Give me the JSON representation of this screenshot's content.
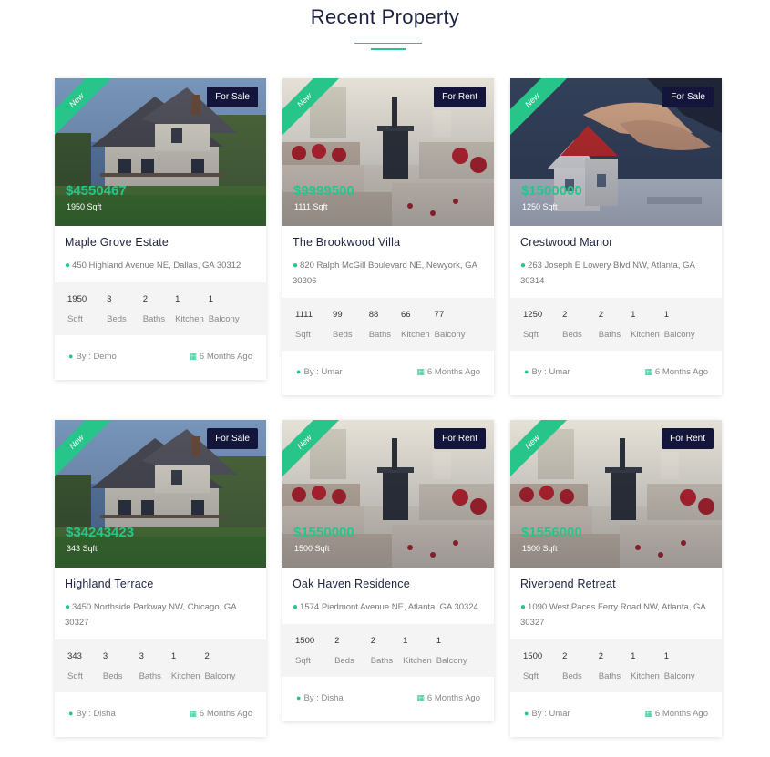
{
  "section": {
    "title": "Recent Property"
  },
  "colors": {
    "accent": "#27c58a",
    "badge": "#13163a"
  },
  "ribbon_label": "New",
  "feature_labels": [
    "Sqft",
    "Beds",
    "Baths",
    "Kitchen",
    "Balcony"
  ],
  "properties": [
    {
      "status": "For Sale",
      "price": "$4550467",
      "area": "1950 Sqft",
      "name": "Maple Grove Estate",
      "address": "450 Highland Avenue NE, Dallas, GA 30312",
      "features": [
        "1950",
        "3",
        "2",
        "1",
        "1"
      ],
      "author": "By : Demo",
      "time": "6 Months Ago",
      "image": "house-icon"
    },
    {
      "status": "For Rent",
      "price": "$9999500",
      "area": "1111 Sqft",
      "name": "The Brookwood Villa",
      "address": "820 Ralph McGill Boulevard NE, Newyork, GA 30306",
      "features": [
        "1111",
        "99",
        "88",
        "66",
        "77"
      ],
      "author": "By : Umar",
      "time": "6 Months Ago",
      "image": "living-room-icon"
    },
    {
      "status": "For Sale",
      "price": "$1500000",
      "area": "1250 Sqft",
      "name": "Crestwood Manor",
      "address": "263 Joseph E Lowery Blvd NW, Atlanta, GA 30314",
      "features": [
        "1250",
        "2",
        "2",
        "1",
        "1"
      ],
      "author": "By : Umar",
      "time": "6 Months Ago",
      "image": "handshake-icon"
    },
    {
      "status": "For Sale",
      "price": "$34243423",
      "area": "343 Sqft",
      "name": "Highland Terrace",
      "address": "3450 Northside Parkway NW, Chicago, GA 30327",
      "features": [
        "343",
        "3",
        "3",
        "1",
        "2"
      ],
      "author": "By : Disha",
      "time": "6 Months Ago",
      "image": "house-icon"
    },
    {
      "status": "For Rent",
      "price": "$1550000",
      "area": "1500 Sqft",
      "name": "Oak Haven Residence",
      "address": "1574 Piedmont Avenue NE, Atlanta, GA 30324",
      "features": [
        "1500",
        "2",
        "2",
        "1",
        "1"
      ],
      "author": "By : Disha",
      "time": "6 Months Ago",
      "image": "living-room-icon"
    },
    {
      "status": "For Rent",
      "price": "$1556000",
      "area": "1500 Sqft",
      "name": "Riverbend Retreat",
      "address": "1090 West Paces Ferry Road NW, Atlanta, GA 30327",
      "features": [
        "1500",
        "2",
        "2",
        "1",
        "1"
      ],
      "author": "By : Umar",
      "time": "6 Months Ago",
      "image": "living-room-icon"
    }
  ]
}
